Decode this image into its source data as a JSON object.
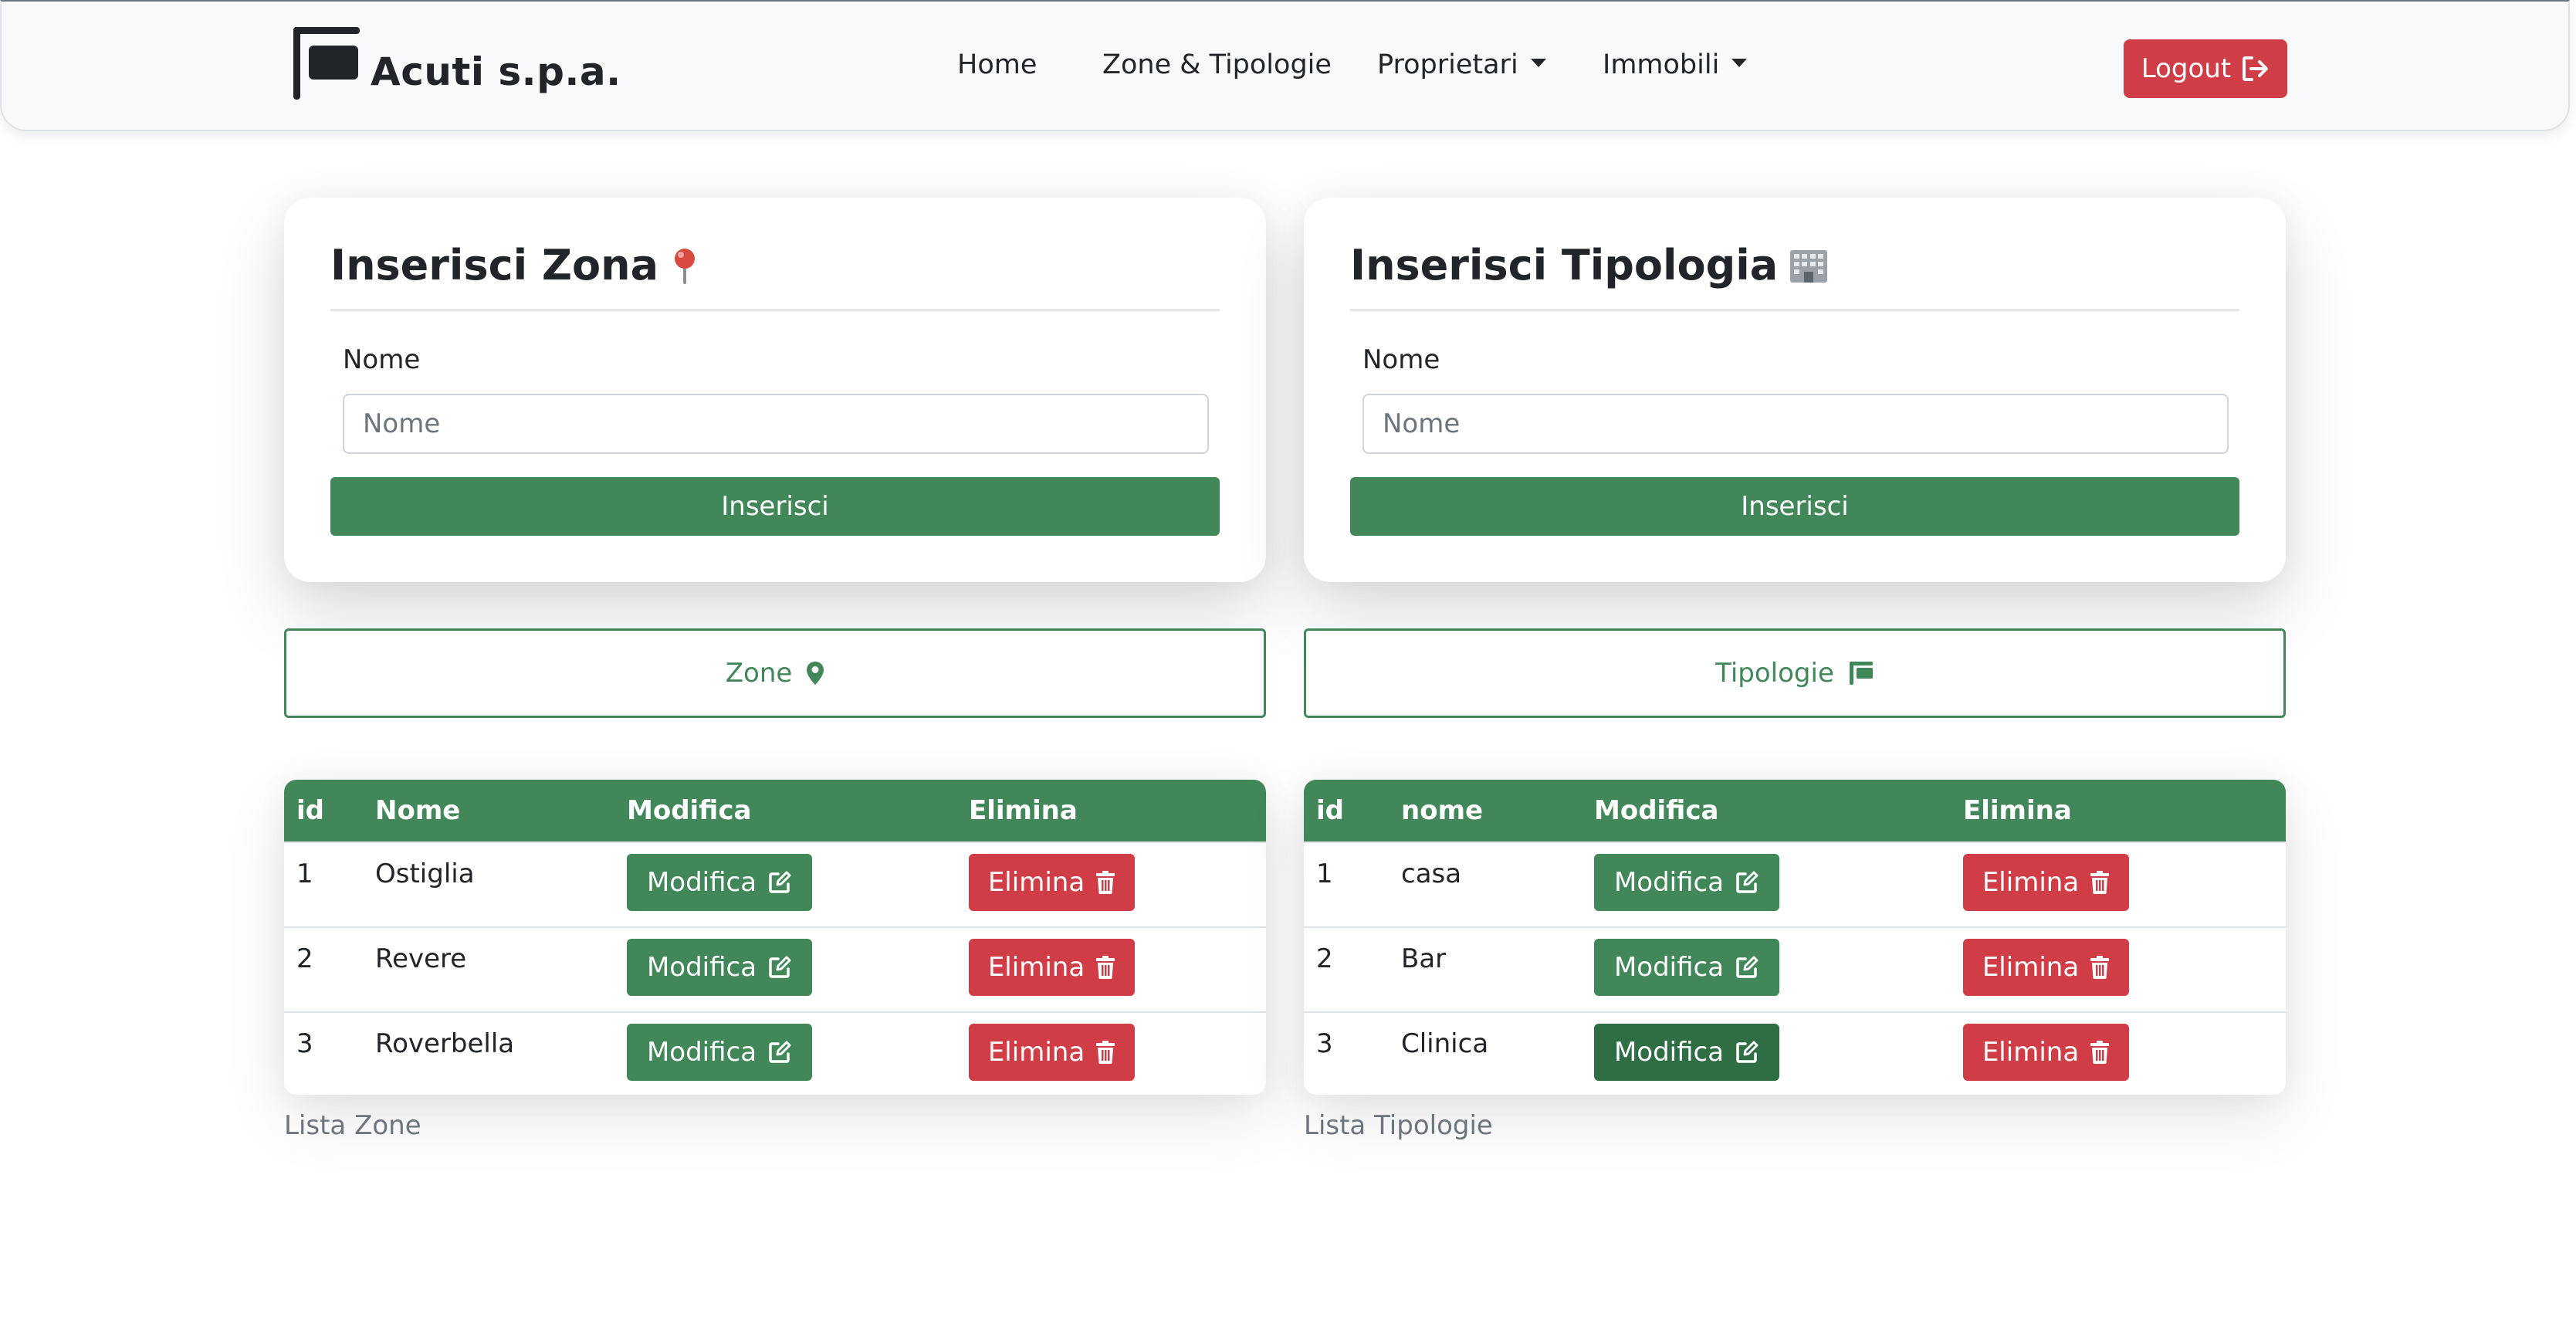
{
  "brand": {
    "name": "Acuti s.p.a."
  },
  "nav": {
    "home": "Home",
    "zone_tipologie": "Zone & Tipologie",
    "proprietari": "Proprietari",
    "immobili": "Immobili",
    "logout": "Logout"
  },
  "zona_form": {
    "title": "Inserisci Zona",
    "icon": "pushpin-icon",
    "label": "Nome",
    "value": "",
    "placeholder": "Nome",
    "submit": "Inserisci"
  },
  "tipologia_form": {
    "title": "Inserisci Tipologia",
    "icon": "office-building-icon",
    "label": "Nome",
    "value": "",
    "placeholder": "Nome",
    "submit": "Inserisci"
  },
  "zone_toggle": {
    "label": "Zone",
    "icon": "map-marker-icon"
  },
  "tipologie_toggle": {
    "label": "Tipologie",
    "icon": "flag-icon"
  },
  "zone_table": {
    "columns": [
      "id",
      "Nome",
      "Modifica",
      "Elimina"
    ],
    "rows": [
      {
        "id": "1",
        "nome": "Ostiglia",
        "modifica": "Modifica",
        "elimina": "Elimina"
      },
      {
        "id": "2",
        "nome": "Revere",
        "modifica": "Modifica",
        "elimina": "Elimina"
      },
      {
        "id": "3",
        "nome": "Roverbella",
        "modifica": "Modifica",
        "elimina": "Elimina"
      }
    ],
    "caption": "Lista Zone"
  },
  "tipologie_table": {
    "columns": [
      "id",
      "nome",
      "Modifica",
      "Elimina"
    ],
    "rows": [
      {
        "id": "1",
        "nome": "casa",
        "modifica": "Modifica",
        "elimina": "Elimina"
      },
      {
        "id": "2",
        "nome": "Bar",
        "modifica": "Modifica",
        "elimina": "Elimina"
      },
      {
        "id": "3",
        "nome": "Clinica",
        "modifica": "Modifica",
        "elimina": "Elimina"
      }
    ],
    "caption": "Lista Tipologie"
  },
  "colors": {
    "primary_green": "#428759",
    "danger_red": "#d13d47",
    "navbar_bg": "#f8f9fa"
  }
}
